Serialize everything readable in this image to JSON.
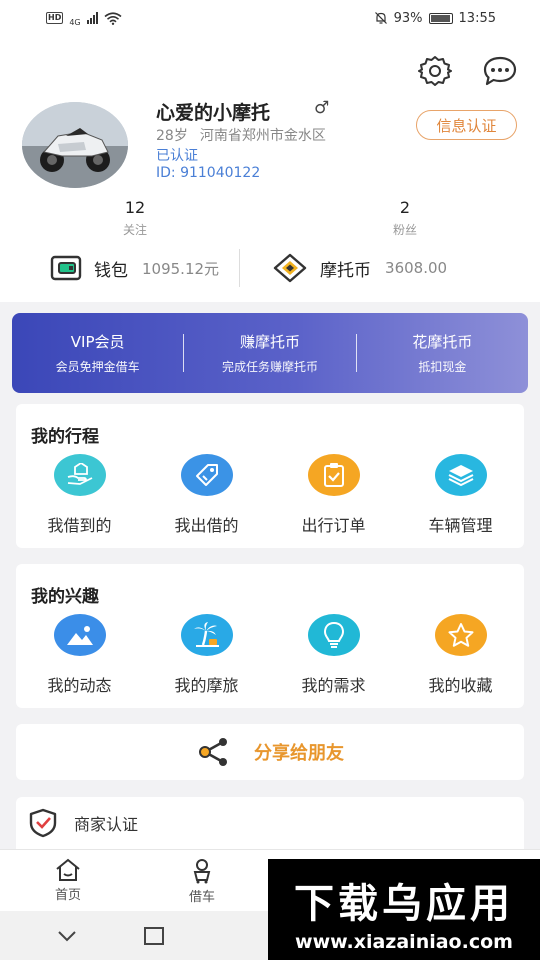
{
  "status_bar": {
    "hd": "HD",
    "network": "4G",
    "battery": "93%",
    "time": "13:55"
  },
  "profile": {
    "nickname": "心爱的小摩托",
    "gender_symbol": "♂",
    "age": "28岁",
    "location": "河南省郑州市金水区",
    "verified": "已认证",
    "user_id": "ID: 911040122",
    "cert_button": "信息认证",
    "stats": [
      {
        "value": "12",
        "label": "关注"
      },
      {
        "value": "2",
        "label": "粉丝"
      }
    ],
    "wallet": {
      "label": "钱包",
      "value": "1095.12元"
    },
    "coin": {
      "label": "摩托币",
      "value": "3608.00"
    }
  },
  "vip_banner": [
    {
      "title": "VIP会员",
      "subtitle": "会员免押金借车"
    },
    {
      "title": "赚摩托币",
      "subtitle": "完成任务赚摩托币"
    },
    {
      "title": "花摩托币",
      "subtitle": "抵扣现金"
    }
  ],
  "trips": {
    "title": "我的行程",
    "items": [
      {
        "label": "我借到的",
        "icon": "hand-home-icon",
        "color": "#3cc6d3"
      },
      {
        "label": "我出借的",
        "icon": "tag-icon",
        "color": "#3b93e6"
      },
      {
        "label": "出行订单",
        "icon": "clipboard-check-icon",
        "color": "#f5a623"
      },
      {
        "label": "车辆管理",
        "icon": "layers-icon",
        "color": "#28b7e0"
      }
    ]
  },
  "interests": {
    "title": "我的兴趣",
    "items": [
      {
        "label": "我的动态",
        "icon": "image-icon",
        "color": "#3b8ee8"
      },
      {
        "label": "我的摩旅",
        "icon": "palm-tree-icon",
        "color": "#29a9e6"
      },
      {
        "label": "我的需求",
        "icon": "lightbulb-icon",
        "color": "#21b8d6"
      },
      {
        "label": "我的收藏",
        "icon": "star-icon",
        "color": "#f5a623"
      }
    ]
  },
  "share": {
    "label": "分享给朋友"
  },
  "merchant": {
    "label": "商家认证"
  },
  "tabbar": [
    {
      "label": "首页",
      "icon": "home-icon"
    },
    {
      "label": "借车",
      "icon": "scooter-icon"
    }
  ],
  "watermark": {
    "title": "下载乌应用",
    "url": "www.xiazainiao.com"
  }
}
